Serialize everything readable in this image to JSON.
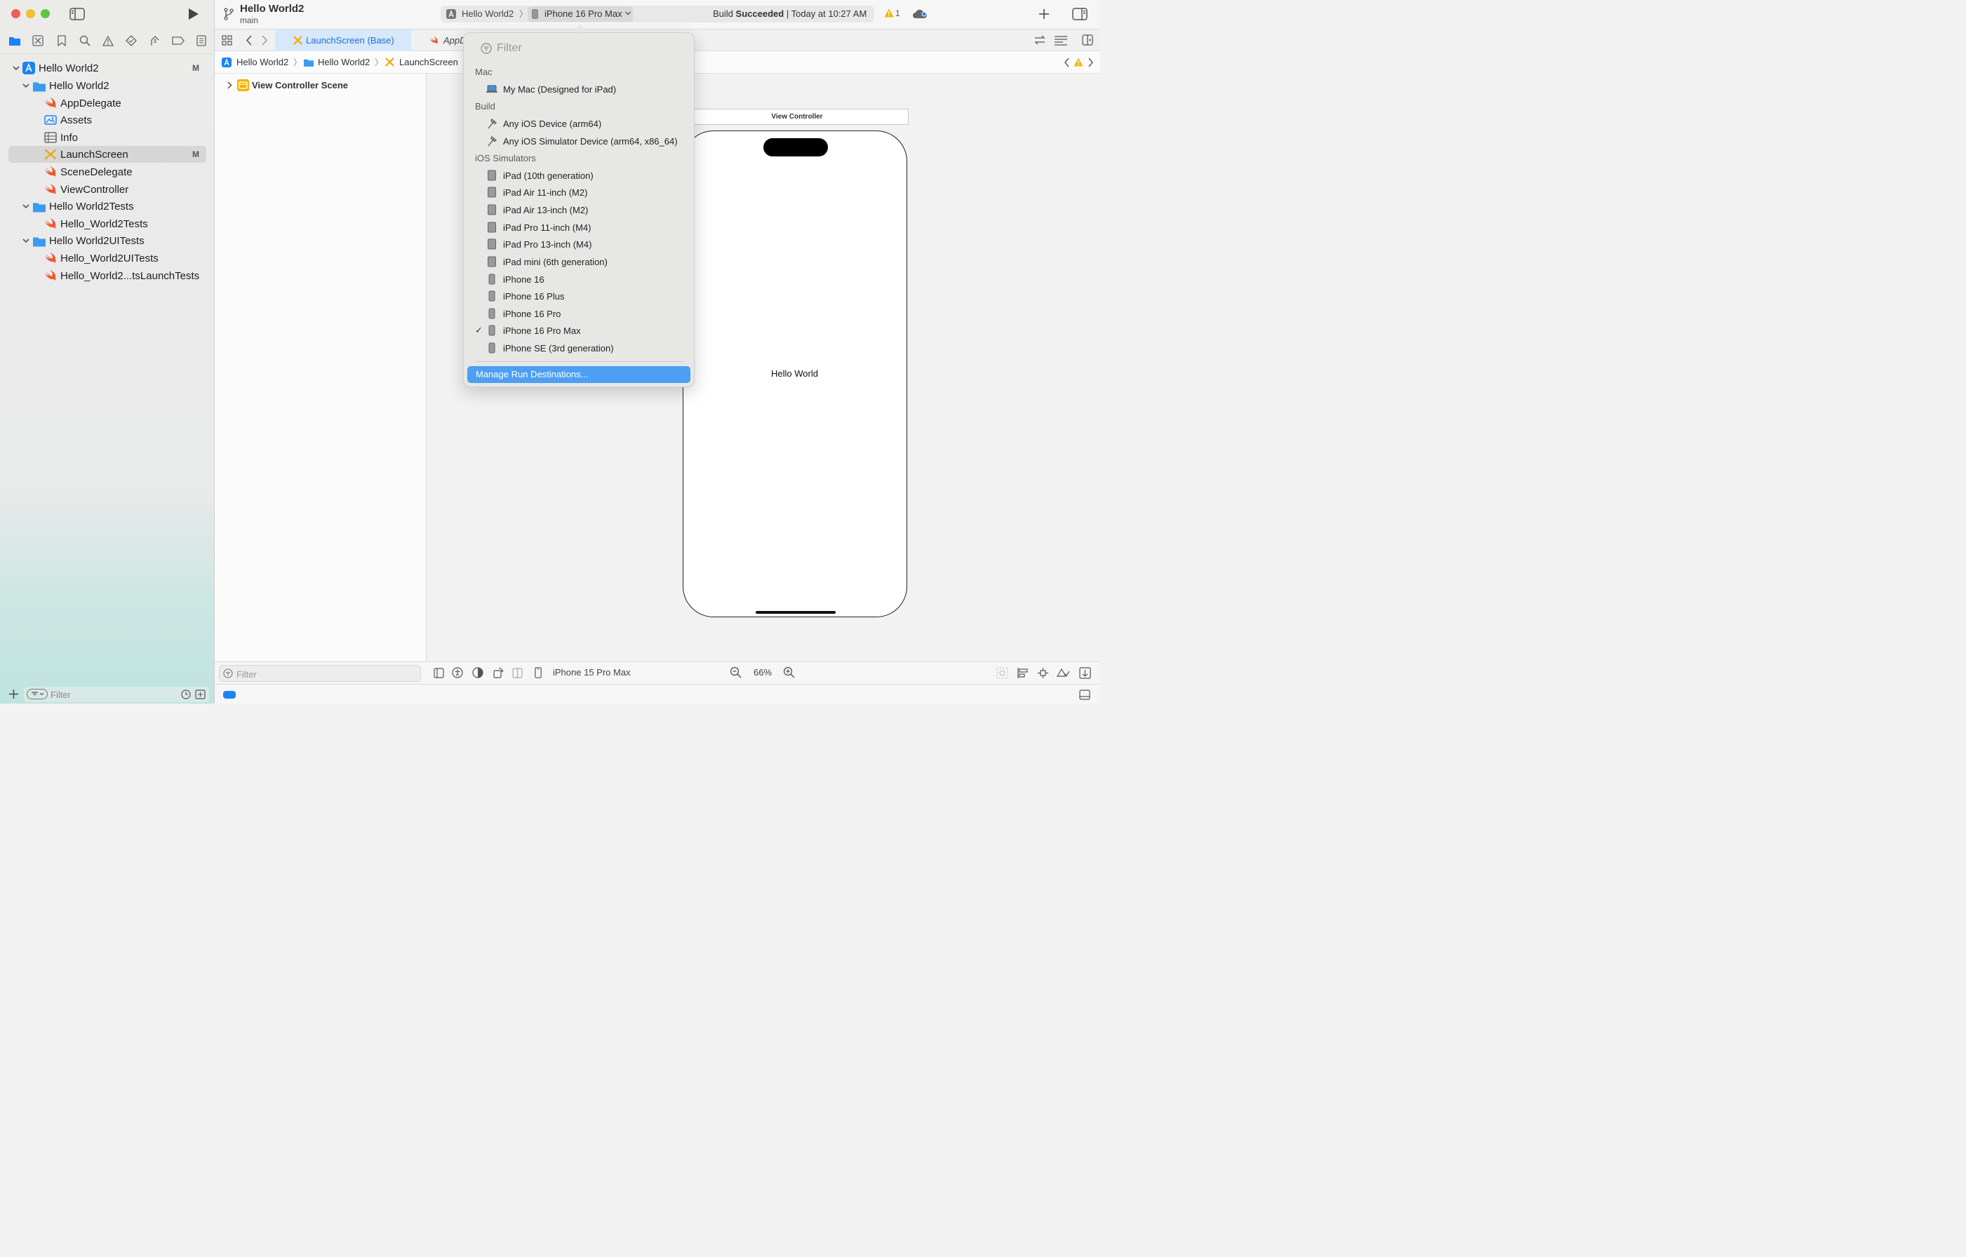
{
  "window": {
    "project_title": "Hello World2",
    "branch": "main"
  },
  "toolbar": {
    "scheme": "Hello World2",
    "destination": "iPhone 16 Pro Max",
    "status_prefix": "Build",
    "status_bold": "Succeeded",
    "status_sep": "|",
    "status_time": "Today at 10:27 AM",
    "warning_count": "1"
  },
  "sidebar": {
    "items": [
      {
        "label": "Hello World2",
        "badge": "M"
      },
      {
        "label": "Hello World2"
      },
      {
        "label": "AppDelegate"
      },
      {
        "label": "Assets"
      },
      {
        "label": "Info"
      },
      {
        "label": "LaunchScreen",
        "badge": "M"
      },
      {
        "label": "SceneDelegate"
      },
      {
        "label": "ViewController"
      },
      {
        "label": "Hello World2Tests"
      },
      {
        "label": "Hello_World2Tests"
      },
      {
        "label": "Hello World2UITests"
      },
      {
        "label": "Hello_World2UITests"
      },
      {
        "label": "Hello_World2...tsLaunchTests"
      }
    ],
    "filter_placeholder": "Filter"
  },
  "tabs": [
    {
      "label": "LaunchScreen (Base)"
    },
    {
      "label": "AppD"
    }
  ],
  "breadcrumb": [
    "Hello World2",
    "Hello World2",
    "LaunchScreen"
  ],
  "outline": {
    "scene": "View Controller Scene",
    "filter_placeholder": "Filter"
  },
  "canvas": {
    "vc_title": "View Controller",
    "label": "Hello World"
  },
  "bottom": {
    "device": "iPhone 15 Pro Max",
    "zoom": "66%"
  },
  "popup": {
    "filter_placeholder": "Filter",
    "sections": {
      "mac": "Mac",
      "build": "Build",
      "sims": "iOS Simulators"
    },
    "mac": [
      "My Mac (Designed for iPad)"
    ],
    "build": [
      "Any iOS Device (arm64)",
      "Any iOS Simulator Device (arm64, x86_64)"
    ],
    "sims": [
      "iPad (10th generation)",
      "iPad Air 11-inch (M2)",
      "iPad Air 13-inch (M2)",
      "iPad Pro 11-inch (M4)",
      "iPad Pro 13-inch (M4)",
      "iPad mini (6th generation)",
      "iPhone 16",
      "iPhone 16 Plus",
      "iPhone 16 Pro",
      "iPhone 16 Pro Max",
      "iPhone SE (3rd generation)"
    ],
    "checked": "iPhone 16 Pro Max",
    "checkmark": "✓",
    "manage": "Manage Run Destinations..."
  },
  "colors": {
    "accent": "#1a83f5",
    "swift": "#f0552b",
    "warning": "#f5b400",
    "selection": "#4c9ff2"
  }
}
